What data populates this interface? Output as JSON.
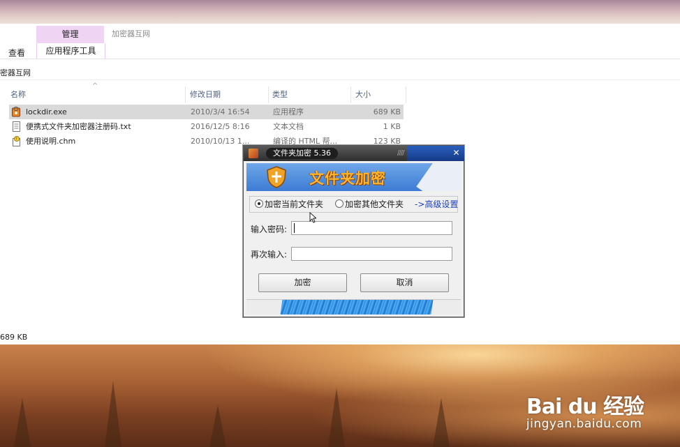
{
  "ribbon": {
    "context_tab": "管理",
    "context_subtab": "应用程序工具",
    "window_title": "加密器互网",
    "view_tab": "查看"
  },
  "address": {
    "path": "密器互网"
  },
  "columns": {
    "name": "名称",
    "date": "修改日期",
    "type": "类型",
    "size": "大小"
  },
  "files": [
    {
      "name": "lockdir.exe",
      "date": "2010/3/4 16:54",
      "type": "应用程序",
      "size": "689 KB",
      "icon": "exe-app-icon",
      "selected": true
    },
    {
      "name": "便携式文件夹加密器注册码.txt",
      "date": "2016/12/5 8:16",
      "type": "文本文档",
      "size": "1 KB",
      "icon": "text-file-icon",
      "selected": false
    },
    {
      "name": "使用说明.chm",
      "date": "2010/10/13 1...",
      "type": "编译的 HTML 帮...",
      "size": "123 KB",
      "icon": "help-file-icon",
      "selected": false
    }
  ],
  "status": {
    "text": "689 KB"
  },
  "dialog": {
    "title": "文件夹加密 5.36",
    "banner": "文件夹加密",
    "option_current": "加密当前文件夹",
    "option_other": "加密其他文件夹",
    "advanced": "->高级设置",
    "password_label": "输入密码:",
    "confirm_label": "再次输入:",
    "password_value": "",
    "confirm_value": "",
    "encrypt_button": "加密",
    "cancel_button": "取消"
  },
  "watermark": {
    "logo": "Bai du 经验",
    "url": "jingyan.baidu.com"
  },
  "colors": {
    "context_tab": "#efd5f3",
    "selection": "#d9d9d9",
    "dialog_blue": "#3d7bd4",
    "banner_text": "#ffb52e"
  }
}
